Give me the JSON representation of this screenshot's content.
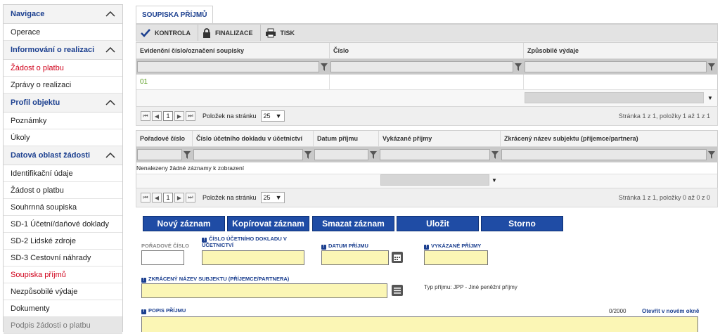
{
  "sidebar": {
    "sections": [
      {
        "title": "Navigace",
        "items": [
          {
            "label": "Operace",
            "state": "normal"
          }
        ]
      },
      {
        "title": "Informování o realizaci",
        "items": [
          {
            "label": "Žádost o platbu",
            "state": "active"
          },
          {
            "label": "Zprávy o realizaci",
            "state": "normal"
          }
        ]
      },
      {
        "title": "Profil objektu",
        "items": [
          {
            "label": "Poznámky",
            "state": "normal"
          },
          {
            "label": "Úkoly",
            "state": "normal"
          }
        ]
      },
      {
        "title": "Datová oblast žádosti",
        "items": [
          {
            "label": "Identifikační údaje",
            "state": "normal"
          },
          {
            "label": "Žádost o platbu",
            "state": "normal"
          },
          {
            "label": "Souhrnná soupiska",
            "state": "normal"
          },
          {
            "label": "SD-1 Účetní/daňové doklady",
            "state": "normal"
          },
          {
            "label": "SD-2 Lidské zdroje",
            "state": "normal"
          },
          {
            "label": "SD-3 Cestovní náhrady",
            "state": "normal"
          },
          {
            "label": "Soupiska příjmů",
            "state": "active"
          },
          {
            "label": "Nezpůsobilé výdaje",
            "state": "normal"
          },
          {
            "label": "Dokumenty",
            "state": "normal"
          },
          {
            "label": "Podpis žádosti o platbu",
            "state": "disabled"
          }
        ]
      }
    ]
  },
  "tab": {
    "label": "SOUPISKA PŘÍJMŮ"
  },
  "toolbar": {
    "kontrola": "KONTROLA",
    "finalizace": "FINALIZACE",
    "tisk": "TISK"
  },
  "grid1": {
    "headers": [
      "Evidenční číslo/označení soupisky",
      "Číslo",
      "Způsobilé výdaje"
    ],
    "rows": [
      [
        "01",
        "",
        ""
      ]
    ]
  },
  "pager1": {
    "page": "1",
    "per_page_label": "Položek na stránku",
    "per_page": "25",
    "info": "Stránka 1 z 1, položky 1 až 1 z 1"
  },
  "grid2": {
    "headers": [
      "Pořadové číslo",
      "Číslo účetního dokladu v účetnictví",
      "Datum příjmu",
      "Vykázané příjmy",
      "Zkrácený název subjektu (příjemce/partnera)"
    ],
    "empty": "Nenalezeny žádné záznamy k zobrazení"
  },
  "pager2": {
    "page": "1",
    "per_page_label": "Položek na stránku",
    "per_page": "25",
    "info": "Stránka 1 z 1, položky 0 až 0 z 0"
  },
  "actions": {
    "new": "Nový záznam",
    "copy": "Kopírovat záznam",
    "delete": "Smazat záznam",
    "save": "Uložit",
    "cancel": "Storno"
  },
  "form": {
    "poradove_cislo": "POŘADOVÉ ČÍSLO",
    "cislo_dokladu": "ČÍSLO ÚČETNÍHO DOKLADU V ÚČETNICTVÍ",
    "datum_prijmu": "DATUM PŘÍJMU",
    "vykazane_prijmy": "VYKÁZANÉ PŘÍJMY",
    "zkraceny_nazev": "ZKRÁCENÝ NÁZEV SUBJEKTU (PŘÍJEMCE/PARTNERA)",
    "typ_prijmu": "Typ příjmu: JPP - Jiné peněžní příjmy",
    "popis_prijmu": "POPIS PŘÍJMU",
    "char_count": "0/2000",
    "open_new_window": "Otevřít v novém okně"
  },
  "colors": {
    "accent": "#1b3f8f",
    "button": "#1f4ca5",
    "active": "#d0021b",
    "required_input": "#fbf6b5",
    "link_green": "#5a9e21"
  }
}
